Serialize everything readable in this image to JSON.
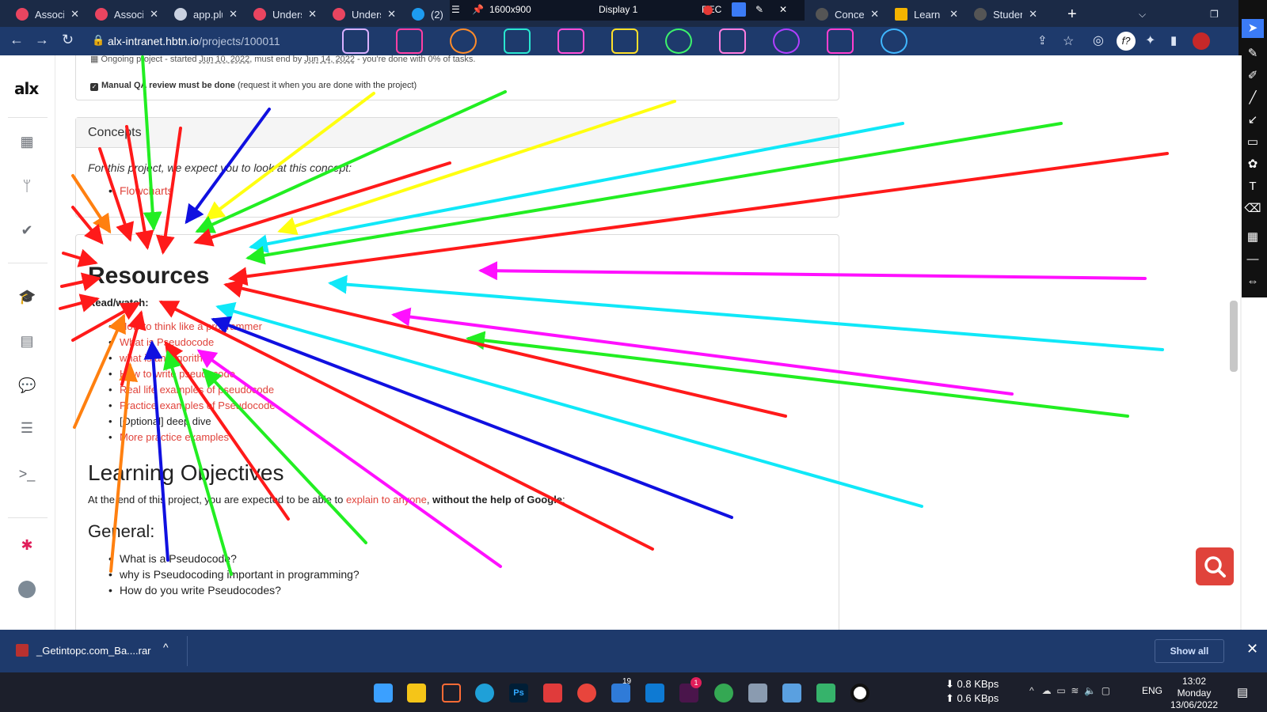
{
  "browser": {
    "tabs": [
      {
        "label": "Associa",
        "icon": "app-icon",
        "color": "#e94560"
      },
      {
        "label": "Associa",
        "icon": "app-icon",
        "color": "#e94560"
      },
      {
        "label": "app.plu",
        "icon": "globe-icon",
        "color": "#c9d1e0"
      },
      {
        "label": "Unders",
        "icon": "app-icon",
        "color": "#e94560"
      },
      {
        "label": "Unders",
        "icon": "app-icon",
        "color": "#e94560"
      },
      {
        "label": "(2)",
        "icon": "twitter-icon",
        "color": "#1d9bf0"
      },
      {
        "label": "Conce",
        "icon": "alx-icon",
        "color": "#555"
      },
      {
        "label": "Learn",
        "icon": "learn-icon",
        "color": "#f4b400"
      },
      {
        "label": "Studen",
        "icon": "alx-icon",
        "color": "#555"
      }
    ],
    "overlay": {
      "resolution": "1600x900",
      "display": "Display 1",
      "rec": "REC"
    },
    "url_host": "alx-intranet.hbtn.io",
    "url_path": "/projects/100011"
  },
  "sidebar": {
    "logo": "alx",
    "items": [
      "calendar-icon",
      "git-branch-icon",
      "check-icon",
      "graduation-cap-icon",
      "document-icon",
      "chat-icon",
      "servers-icon",
      "terminal-icon",
      "slack-icon",
      "avatar"
    ]
  },
  "project": {
    "meta_prefix": "Ongoing project - started",
    "start_date": "Jun 10, 2022",
    "meta_mid": ", must end by",
    "end_date": "Jun 14, 2022",
    "meta_suffix": "- you're done with 0% of tasks.",
    "qa_bold": "Manual QA review must be done",
    "qa_note": "(request it when you are done with the project)"
  },
  "concepts": {
    "title": "Concepts",
    "intro": "For this project, we expect you to look at this concept:",
    "link": "Flowcharts"
  },
  "resources": {
    "title": "Resources",
    "subtitle": "Read/watch:",
    "items": [
      "How to think like a programmer",
      "What is Pseudocode",
      "what is an algorithm",
      "How to write pseudocode",
      "Real life examples of pseudocode",
      "Practice examples of Pseudocode",
      "[Optional] deep dive",
      "More practice examples"
    ]
  },
  "objectives": {
    "title": "Learning Objectives",
    "text_before": "At the end of this project, you are expected to be able to",
    "link": "explain to anyone",
    "text_bold": "without the help of Google",
    "general_title": "General:",
    "general_items": [
      "What is a Pseudocode?",
      "why is Pseudocoding important in programming?",
      "How do you write Pseudocodes?"
    ]
  },
  "downloads": {
    "file": "_Getintopc.com_Ba....rar",
    "show_all": "Show all"
  },
  "taskbar": {
    "down_speed": "0.8 KBps",
    "up_speed": "0.6 KBps",
    "lang": "ENG",
    "time": "13:02",
    "day": "Monday",
    "date": "13/06/2022",
    "badge_1": "19",
    "badge_2": "1"
  },
  "colors": {
    "accent": "#e0433b",
    "chrome": "#1e3a6c",
    "annotation_red": "#ff1a1a",
    "annotation_green": "#22ee22",
    "annotation_blue": "#1010e0",
    "annotation_cyan": "#10e8f8",
    "annotation_magenta": "#ff10ff",
    "annotation_yellow": "#ffff10",
    "annotation_orange": "#ff8010"
  }
}
